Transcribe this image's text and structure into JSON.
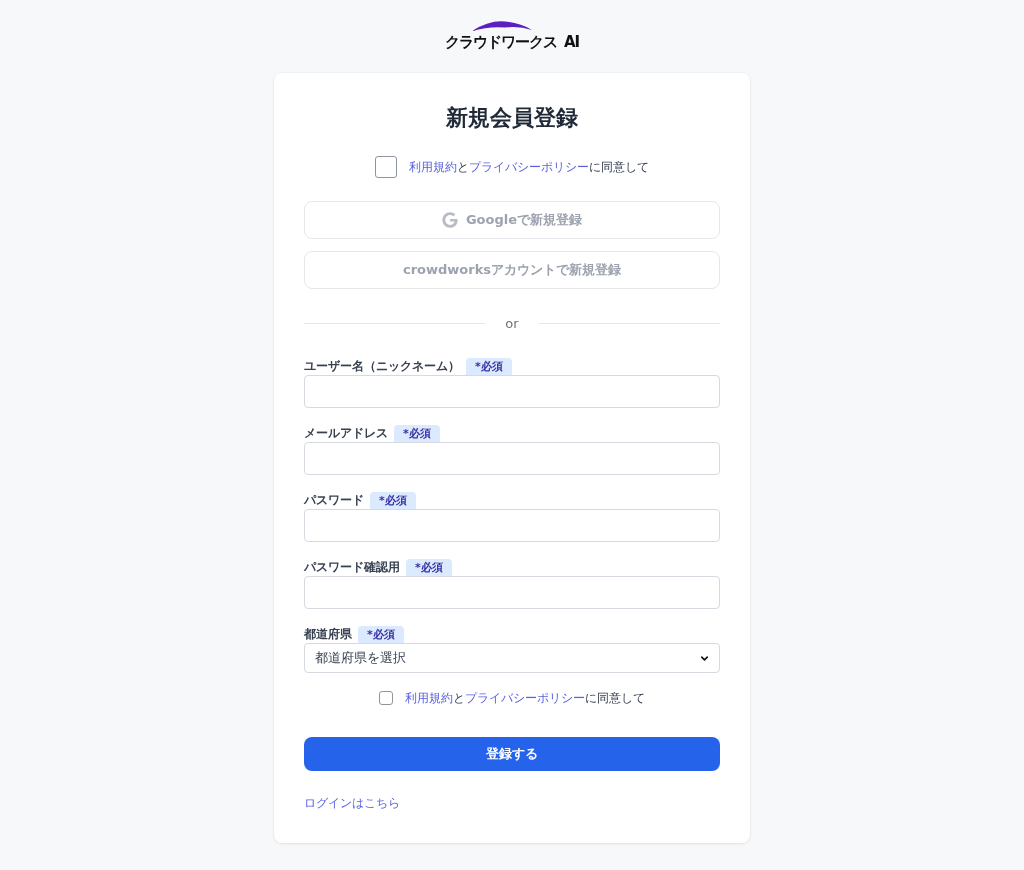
{
  "logo": {
    "text": "クラウドワークス AI"
  },
  "title": "新規会員登録",
  "top_consent": {
    "checked": false,
    "parts": [
      {
        "kind": "link",
        "text": "利用規約"
      },
      {
        "kind": "text",
        "text": "と"
      },
      {
        "kind": "link",
        "text": "プライバシーポリシー"
      },
      {
        "kind": "text",
        "text": "に同意して"
      }
    ]
  },
  "social_buttons": [
    {
      "kind": "google",
      "label": "Googleで新規登録",
      "disabled": true
    },
    {
      "kind": "crowdworks",
      "label": "crowdworksアカウントで新規登録",
      "disabled": true
    }
  ],
  "divider": "or",
  "fields": [
    {
      "kind": "input",
      "label": "ユーザー名（ニックネーム）",
      "badge": "*必須"
    },
    {
      "kind": "input",
      "label": "メールアドレス",
      "badge": "*必須"
    },
    {
      "kind": "input",
      "label": "パスワード",
      "badge": "*必須"
    },
    {
      "kind": "input",
      "label": "パスワード確認用",
      "badge": "*必須"
    },
    {
      "kind": "select",
      "label": "都道府県",
      "badge": "*必須",
      "value": "都道府県を選択"
    }
  ],
  "bottom_consent": {
    "checked": false,
    "parts": [
      {
        "kind": "link",
        "text": "利用規約"
      },
      {
        "kind": "text",
        "text": "と"
      },
      {
        "kind": "link",
        "text": "プライバシーポリシー"
      },
      {
        "kind": "text",
        "text": "に同意して"
      }
    ]
  },
  "submit": {
    "label": "登録する"
  },
  "login_link": "ログインはこちら"
}
